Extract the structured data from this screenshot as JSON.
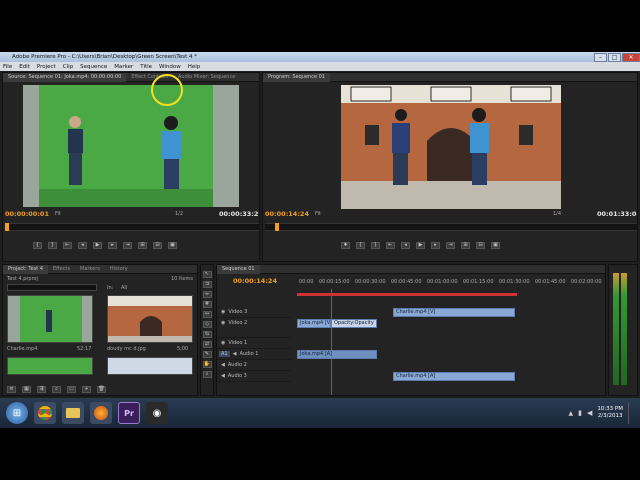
{
  "window": {
    "title": "Adobe Premiere Pro - C:\\Users\\Brian\\Desktop\\Green Screen\\Test 4 *"
  },
  "menu": [
    "File",
    "Edit",
    "Project",
    "Clip",
    "Sequence",
    "Marker",
    "Title",
    "Window",
    "Help"
  ],
  "source_panel": {
    "tabs": [
      "Source: Sequence 01: Joka.mp4: 00:00:00:00",
      "Effect Controls",
      "Audio Mixer: Sequence"
    ],
    "timecode_in": "00:00:00:01",
    "fit": "Fit",
    "fraction": "1/2",
    "timecode_out": "00:00:33:29"
  },
  "program_panel": {
    "tabs": [
      "Program: Sequence 01"
    ],
    "timecode_in": "00:00:14:24",
    "fit": "Fit",
    "fraction": "1/4",
    "timecode_out": "00:01:33:08"
  },
  "project_panel": {
    "tabs": [
      "Project: Test 4",
      "Effects",
      "Markers",
      "History"
    ],
    "project_name": "Test 4.prproj",
    "item_count": "10 Items",
    "in_label": "In:",
    "in_value": "All",
    "items": [
      {
        "name": "Charlie.mp4",
        "duration": "52:17"
      },
      {
        "name": "doudy mc d.jpg",
        "duration": "5;00"
      }
    ]
  },
  "timeline": {
    "tabs": [
      "Sequence 01"
    ],
    "timecode": "00:00:14:24",
    "ruler": [
      "00:00",
      "00:00:15:00",
      "00:00:30:00",
      "00:00:45:00",
      "00:01:00:00",
      "00:01:15:00",
      "00:01:30:00",
      "00:01:45:00",
      "00:02:00:00"
    ],
    "tracks": [
      "Video 3",
      "Video 2",
      "Video 1",
      "Audio 1",
      "Audio 2",
      "Audio 3"
    ],
    "a1_label": "A1",
    "clips": [
      {
        "label": "Charlie.mp4 [V]"
      },
      {
        "label": "Joka.mp4 [V]"
      },
      {
        "label": "Opacity:Opacity"
      },
      {
        "label": "Joka.mp4 [A]"
      },
      {
        "label": "Charlie.mp4 [A]"
      }
    ]
  },
  "taskbar": {
    "time": "10:33 PM",
    "date": "2/3/2013",
    "icons": [
      "windows-start",
      "chrome",
      "explorer",
      "firefox",
      "premiere",
      "webcam"
    ]
  }
}
